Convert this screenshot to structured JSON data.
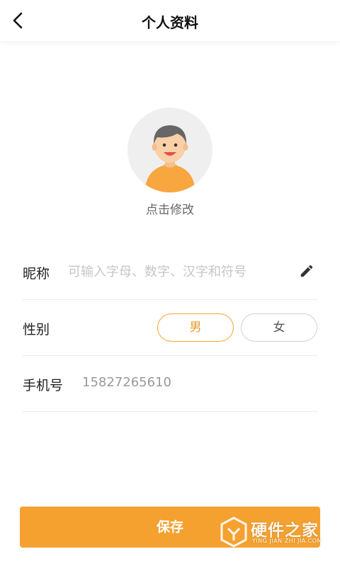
{
  "header": {
    "title": "个人资料",
    "back_icon": "chevron-left-icon"
  },
  "avatar": {
    "icon": "user-avatar-icon",
    "hint": "点击修改"
  },
  "form": {
    "nickname": {
      "label": "昵称",
      "placeholder": "可输入字母、数字、汉字和符号",
      "value": "",
      "icon": "pencil-icon"
    },
    "gender": {
      "label": "性别",
      "options": [
        "男",
        "女"
      ],
      "selected": "男"
    },
    "phone": {
      "label": "手机号",
      "value": "15827265610"
    }
  },
  "footer": {
    "save_label": "保存"
  },
  "watermark": {
    "title": "硬件之家",
    "subtitle": "YING JIAN ZHI JIA.COM"
  },
  "colors": {
    "accent": "#f5a12f",
    "divider": "#ececec",
    "placeholder": "#c6c6c6"
  }
}
